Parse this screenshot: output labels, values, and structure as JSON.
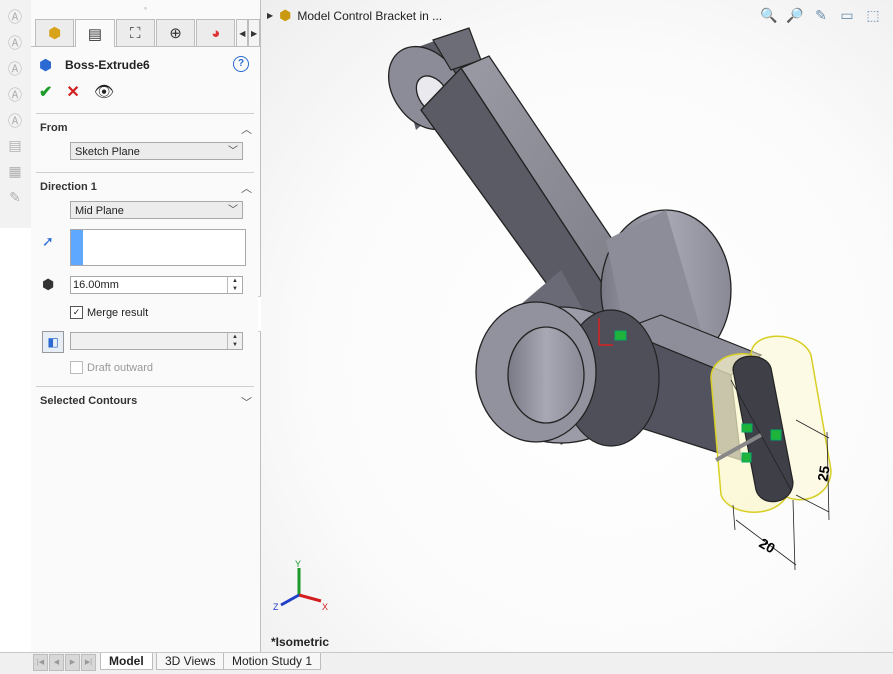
{
  "left_strip": {
    "icons": [
      "annotation-icon",
      "annotation-icon",
      "annotation-icon",
      "annotation-icon",
      "annotation-icon",
      "annotation-icon",
      "annotation-icon",
      "annotation-icon"
    ]
  },
  "property_manager": {
    "tabs": [
      "featuremanager-tab-icon",
      "propertymanager-tab-icon",
      "configurationmanager-tab-icon",
      "dimxpert-tab-icon",
      "display-manager-tab-icon"
    ],
    "feature_name": "Boss-Extrude6",
    "from": {
      "title": "From",
      "value": "Sketch Plane"
    },
    "direction1": {
      "title": "Direction 1",
      "end_condition": "Mid Plane",
      "depth": "16.00mm",
      "merge_label": "Merge result",
      "merge_checked": true,
      "draft_value": "",
      "draft_outward_label": "Draft outward"
    },
    "selected_contours": {
      "title": "Selected Contours"
    }
  },
  "viewport": {
    "tree_label": "Model Control Bracket in ...",
    "view_name": "*Isometric",
    "dimensions": {
      "width": "20",
      "height": "25"
    },
    "triad": {
      "x": "X",
      "y": "Y",
      "z": "Z"
    }
  },
  "bottom_tabs": {
    "tabs": [
      "Model",
      "3D Views",
      "Motion Study 1"
    ],
    "active": "Model"
  }
}
